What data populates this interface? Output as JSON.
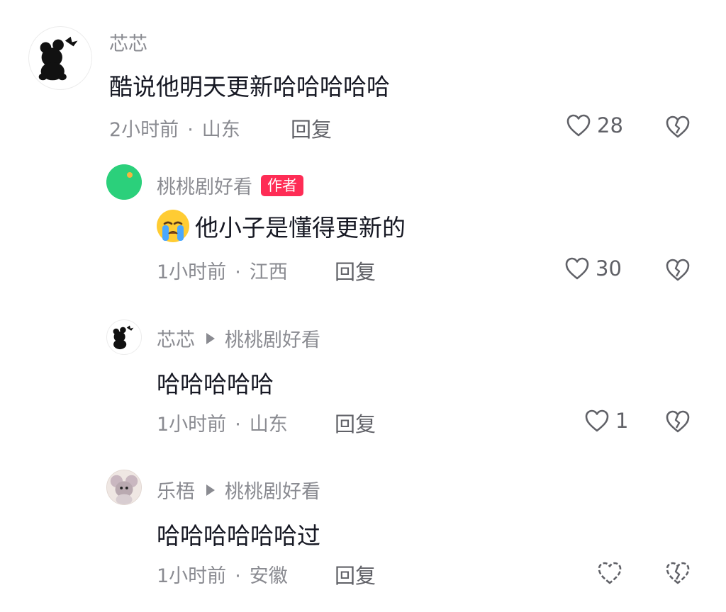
{
  "comments": [
    {
      "username": "芯芯",
      "text": "酷说他明天更新哈哈哈哈哈",
      "time": "2小时前",
      "location": "山东",
      "reply_label": "回复",
      "likes": "28"
    },
    {
      "username": "桃桃剧好看",
      "badge": "作者",
      "text": "他小子是懂得更新的",
      "time": "1小时前",
      "location": "江西",
      "reply_label": "回复",
      "likes": "30",
      "avatar_text": "桃桃剧好看"
    },
    {
      "username": "芯芯",
      "reply_to": "桃桃剧好看",
      "text": "哈哈哈哈哈",
      "time": "1小时前",
      "location": "山东",
      "reply_label": "回复",
      "likes": "1"
    },
    {
      "username": "乐梧",
      "reply_to": "桃桃剧好看",
      "text": "哈哈哈哈哈哈过",
      "time": "1小时前",
      "location": "安徽",
      "reply_label": "回复",
      "likes": ""
    }
  ],
  "colors": {
    "author_badge": "#fe2c55",
    "meta_text": "#8a8b91",
    "avatar_green": "#2bd07b"
  },
  "icons": {
    "like": "heart-outline-icon",
    "dislike": "broken-heart-icon",
    "reply_arrow": "triangle-right-icon",
    "emoji": "crying-face-emoji"
  }
}
